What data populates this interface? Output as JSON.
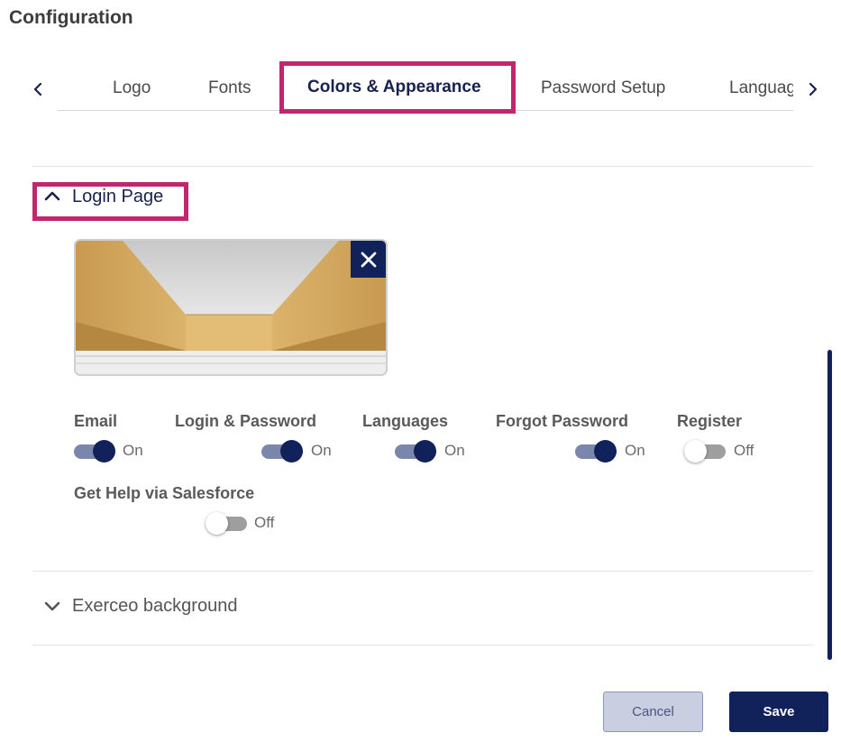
{
  "page": {
    "title": "Configuration"
  },
  "tabs": [
    {
      "label": "Logo",
      "active": false
    },
    {
      "label": "Fonts",
      "active": false
    },
    {
      "label": "Colors & Appearance",
      "active": true
    },
    {
      "label": "Password Setup",
      "active": false
    },
    {
      "label": "Languages",
      "active": false
    }
  ],
  "sections": {
    "login_page": {
      "title": "Login Page",
      "expanded": true,
      "toggles": [
        {
          "label": "Email",
          "state": "On"
        },
        {
          "label": "Login & Password",
          "state": "On"
        },
        {
          "label": "Languages",
          "state": "On"
        },
        {
          "label": "Forgot Password",
          "state": "On"
        },
        {
          "label": "Register",
          "state": "Off"
        },
        {
          "label": "Get Help via Salesforce",
          "state": "Off"
        }
      ]
    },
    "exerceo_background": {
      "title": "Exerceo background",
      "expanded": false
    }
  },
  "footer": {
    "cancel_label": "Cancel",
    "save_label": "Save"
  },
  "colors": {
    "primary": "#11215a",
    "toggle_track_on": "#7b86ad",
    "highlight": "#c2266e",
    "cancel_bg": "#c9cee0"
  },
  "icons": {
    "tab_prev": "chevron-left-icon",
    "tab_next": "chevron-right-icon",
    "section_expanded": "chevron-up-icon",
    "section_collapsed": "chevron-down-icon",
    "remove_image": "close-icon"
  }
}
